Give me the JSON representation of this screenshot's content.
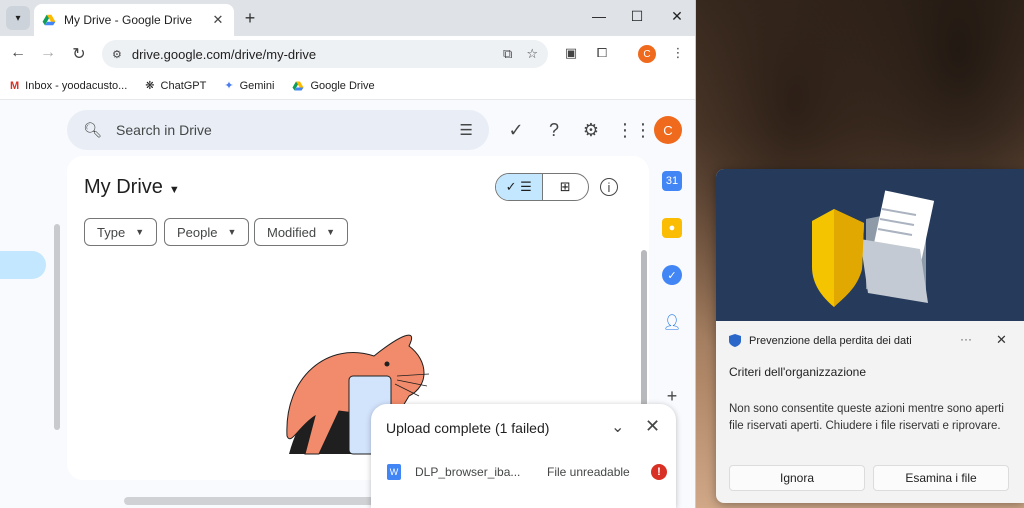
{
  "browser": {
    "tab_title": "My Drive - Google Drive",
    "url": "drive.google.com/drive/my-drive",
    "profile_initial": "C",
    "bookmarks": [
      {
        "label": "Inbox - yoodacusto...",
        "icon": "gmail-icon"
      },
      {
        "label": "ChatGPT",
        "icon": "chatgpt-icon"
      },
      {
        "label": "Gemini",
        "icon": "gemini-icon"
      },
      {
        "label": "Google Drive",
        "icon": "drive-icon"
      }
    ]
  },
  "drive": {
    "search_placeholder": "Search in Drive",
    "title": "My Drive",
    "avatar_initial": "C",
    "filters": [
      "Type",
      "People",
      "Modified"
    ]
  },
  "upload": {
    "title": "Upload complete (1 failed)",
    "file_name": "DLP_browser_iba...",
    "file_status": "File unreadable"
  },
  "notification": {
    "app_name": "Prevenzione della perdita dei dati",
    "title": "Criteri dell'organizzazione",
    "body": "Non sono consentite queste azioni mentre sono aperti file riservati aperti. Chiudere i file riservati e riprovare.",
    "button_ignore": "Ignora",
    "button_review": "Esamina i file",
    "more_glyph": "···"
  },
  "colors": {
    "accent": "#c2e7ff",
    "avatar": "#f06a1d",
    "error": "#d93025",
    "notif_hero": "#263b5c"
  }
}
